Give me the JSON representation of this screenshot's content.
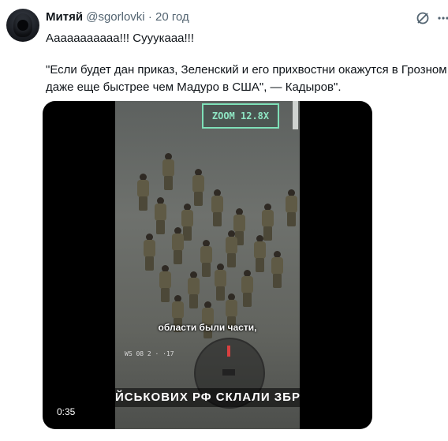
{
  "tweet": {
    "author_name": "Митяй",
    "handle": "@sgorlovki",
    "separator": "·",
    "time": "20 год",
    "lines": [
      "Ааааааааааа!!! Сууукааа!!!",
      "\"Если будет дан приказ, Зеленский и его прихвостни окажутся в Грозном",
      "даже еще быстрее чем Мадуро в США\", — Кадыров\"."
    ]
  },
  "icons": {
    "grok": "grok-icon",
    "more": "more-icon",
    "avatar": "avatar"
  },
  "video": {
    "zoom_label": "ZOOM 12.8X",
    "subtitle": "области были части,",
    "hud_text": "WS 08 2 · ·17",
    "banner_text": "ЙСЬКОВИХ РФ СКЛАЛИ ЗБРОЮ",
    "duration": "0:35"
  }
}
